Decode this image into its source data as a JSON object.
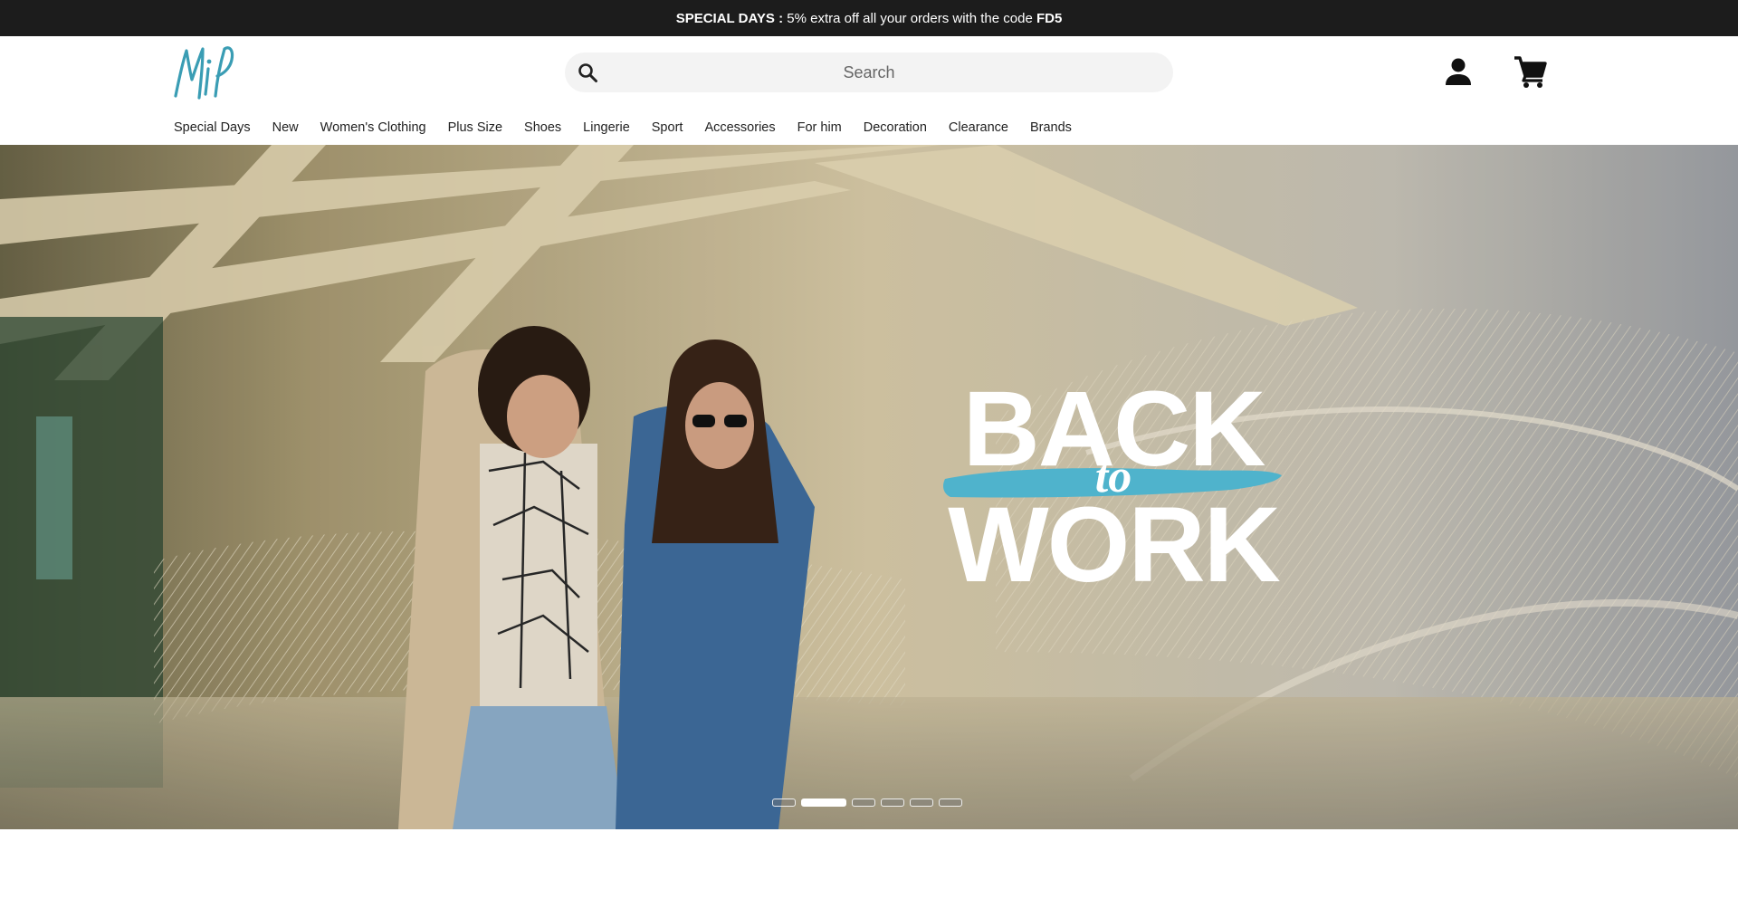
{
  "promo": {
    "label": "SPECIAL DAYS :",
    "text": "5% extra off all your orders with the code",
    "code": "FD5"
  },
  "header": {
    "logo_alt": "Mim logo",
    "search_placeholder": "Search"
  },
  "nav": {
    "items": [
      "Special Days",
      "New",
      "Women's Clothing",
      "Plus Size",
      "Shoes",
      "Lingerie",
      "Sport",
      "Accessories",
      "For him",
      "Decoration",
      "Clearance",
      "Brands"
    ]
  },
  "hero": {
    "headline_top": "BACK",
    "headline_mid": "to",
    "headline_bottom": "WORK",
    "slides_count": 6,
    "active_slide": 2
  },
  "colors": {
    "brand_teal": "#3a9db4",
    "promo_bg": "#1c1c1c",
    "stroke_blue": "#4fb3cc"
  },
  "icons": {
    "search": "search-icon",
    "account": "account-icon",
    "cart": "cart-icon"
  }
}
